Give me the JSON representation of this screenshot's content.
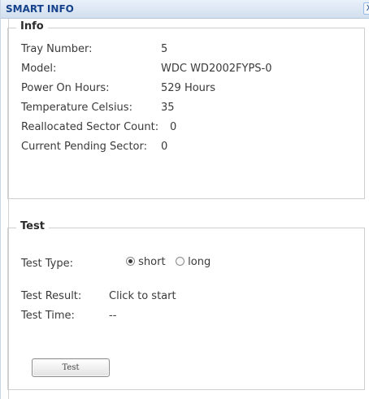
{
  "window": {
    "title": "SMART INFO",
    "close_label": "X"
  },
  "info": {
    "legend": "Info",
    "rows": [
      {
        "label": "Tray Number:",
        "value": "5"
      },
      {
        "label": "Model:",
        "value": "WDC WD2002FYPS-0"
      },
      {
        "label": "Power On Hours:",
        "value": "529 Hours"
      },
      {
        "label": "Temperature Celsius:",
        "value": "35"
      },
      {
        "label": "Reallocated Sector Count:",
        "value": "0"
      },
      {
        "label": "Current Pending Sector:",
        "value": "0"
      }
    ]
  },
  "test": {
    "legend": "Test",
    "type_label": "Test Type:",
    "options": [
      {
        "label": "short",
        "selected": true
      },
      {
        "label": "long",
        "selected": false
      }
    ],
    "result_label": "Test Result:",
    "result_value": "Click to start",
    "time_label": "Test Time:",
    "time_value": "--",
    "button_label": "Test"
  }
}
